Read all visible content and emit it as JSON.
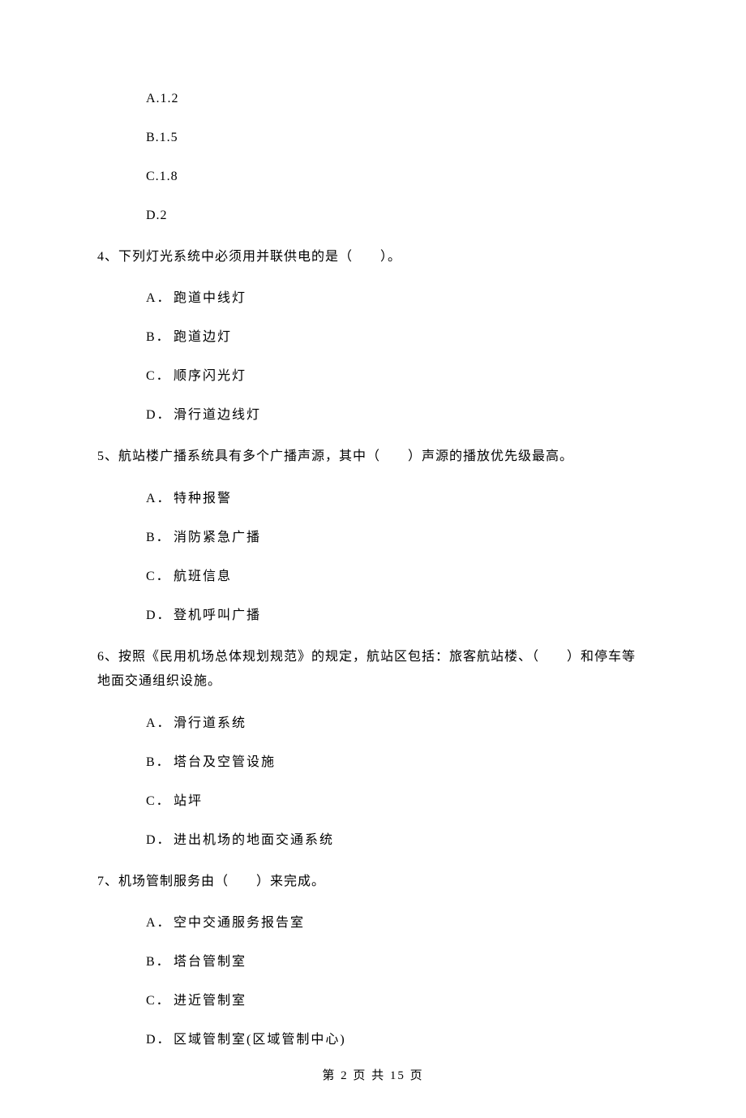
{
  "q3": {
    "options": {
      "a": "A.1.2",
      "b": "B.1.5",
      "c": "C.1.8",
      "d": "D.2"
    }
  },
  "q4": {
    "stem": "4、下列灯光系统中必须用并联供电的是（　　）。",
    "options": {
      "a_label": "A．",
      "a_text": "跑道中线灯",
      "b_label": "B．",
      "b_text": "跑道边灯",
      "c_label": "C．",
      "c_text": "顺序闪光灯",
      "d_label": "D．",
      "d_text": "滑行道边线灯"
    }
  },
  "q5": {
    "stem": "5、航站楼广播系统具有多个广播声源，其中（　　）声源的播放优先级最高。",
    "options": {
      "a_label": "A．",
      "a_text": "特种报警",
      "b_label": "B．",
      "b_text": "消防紧急广播",
      "c_label": "C．",
      "c_text": "航班信息",
      "d_label": "D．",
      "d_text": "登机呼叫广播"
    }
  },
  "q6": {
    "stem": "6、按照《民用机场总体规划规范》的规定，航站区包括：旅客航站楼、（　　）和停车等地面交通组织设施。",
    "options": {
      "a_label": "A．",
      "a_text": "滑行道系统",
      "b_label": "B．",
      "b_text": "塔台及空管设施",
      "c_label": "C．",
      "c_text": "站坪",
      "d_label": "D．",
      "d_text": "进出机场的地面交通系统"
    }
  },
  "q7": {
    "stem": "7、机场管制服务由（　　）来完成。",
    "options": {
      "a_label": "A．",
      "a_text": "空中交通服务报告室",
      "b_label": "B．",
      "b_text": "塔台管制室",
      "c_label": "C．",
      "c_text": "进近管制室",
      "d_label": "D．",
      "d_text": "区域管制室(区域管制中心)"
    }
  },
  "footer": "第 2 页 共 15 页"
}
